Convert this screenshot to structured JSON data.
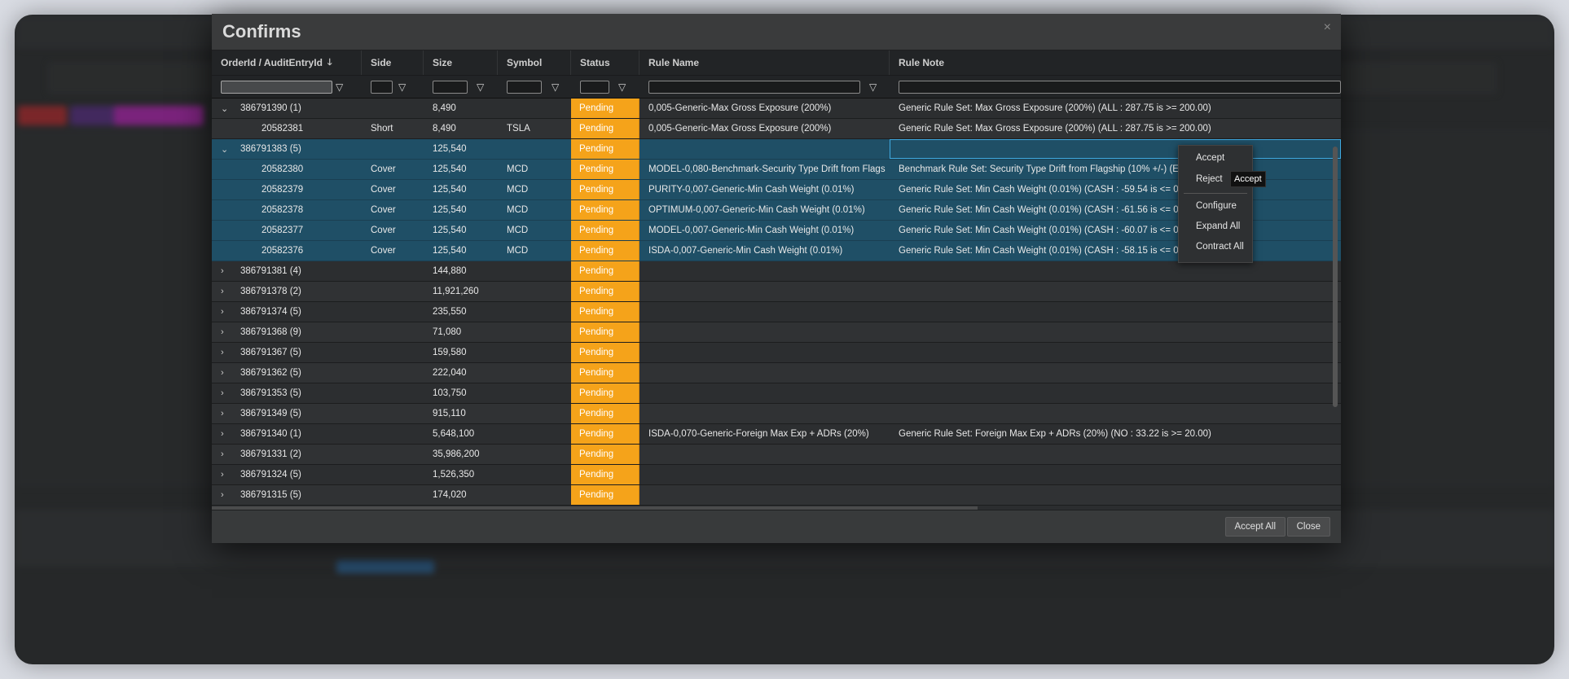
{
  "dialog": {
    "title": "Confirms",
    "close_glyph": "×",
    "accept_all_label": "Accept All",
    "close_label": "Close"
  },
  "columns": [
    {
      "label": "OrderId / AuditEntryId",
      "sorted": "descending"
    },
    {
      "label": "Side"
    },
    {
      "label": "Size"
    },
    {
      "label": "Symbol"
    },
    {
      "label": "Status"
    },
    {
      "label": "Rule Name"
    },
    {
      "label": "Rule Note"
    }
  ],
  "rows": [
    {
      "id": "386791390 (1)",
      "side": "",
      "size": "8,490",
      "symbol": "",
      "status": "Pending",
      "rule_name": "0,005-Generic-Max Gross Exposure (200%)",
      "rule_note": "Generic Rule Set: Max Gross Exposure (200%) (ALL : 287.75 is >= 200.00)"
    },
    {
      "id": "20582381",
      "side": "Short",
      "size": "8,490",
      "symbol": "TSLA",
      "status": "Pending",
      "rule_name": "0,005-Generic-Max Gross Exposure (200%)",
      "rule_note": "Generic Rule Set: Max Gross Exposure (200%) (ALL : 287.75 is >= 200.00)"
    },
    {
      "id": "386791383 (5)",
      "side": "",
      "size": "125,540",
      "symbol": "",
      "status": "Pending",
      "rule_name": "",
      "rule_note": ""
    },
    {
      "id": "20582380",
      "side": "Cover",
      "size": "125,540",
      "symbol": "MCD",
      "status": "Pending",
      "rule_name": "MODEL-0,080-Benchmark-Security Type Drift from Flags",
      "rule_note": "Benchmark Rule Set: Security Type Drift from Flagship (10% +/-) (EQUITY"
    },
    {
      "id": "20582379",
      "side": "Cover",
      "size": "125,540",
      "symbol": "MCD",
      "status": "Pending",
      "rule_name": "PURITY-0,007-Generic-Min Cash Weight (0.01%)",
      "rule_note": "Generic Rule Set: Min Cash Weight (0.01%) (CASH : -59.54 is <= 0.01)"
    },
    {
      "id": "20582378",
      "side": "Cover",
      "size": "125,540",
      "symbol": "MCD",
      "status": "Pending",
      "rule_name": "OPTIMUM-0,007-Generic-Min Cash Weight (0.01%)",
      "rule_note": "Generic Rule Set: Min Cash Weight (0.01%) (CASH : -61.56 is <= 0.01)"
    },
    {
      "id": "20582377",
      "side": "Cover",
      "size": "125,540",
      "symbol": "MCD",
      "status": "Pending",
      "rule_name": "MODEL-0,007-Generic-Min Cash Weight (0.01%)",
      "rule_note": "Generic Rule Set: Min Cash Weight (0.01%) (CASH : -60.07 is <= 0.01)"
    },
    {
      "id": "20582376",
      "side": "Cover",
      "size": "125,540",
      "symbol": "MCD",
      "status": "Pending",
      "rule_name": "ISDA-0,007-Generic-Min Cash Weight (0.01%)",
      "rule_note": "Generic Rule Set: Min Cash Weight (0.01%) (CASH : -58.15 is <= 0.01)"
    },
    {
      "id": "386791381 (4)",
      "side": "",
      "size": "144,880",
      "symbol": "",
      "status": "Pending",
      "rule_name": "",
      "rule_note": ""
    },
    {
      "id": "386791378 (2)",
      "side": "",
      "size": "11,921,260",
      "symbol": "",
      "status": "Pending",
      "rule_name": "",
      "rule_note": ""
    },
    {
      "id": "386791374 (5)",
      "side": "",
      "size": "235,550",
      "symbol": "",
      "status": "Pending",
      "rule_name": "",
      "rule_note": ""
    },
    {
      "id": "386791368 (9)",
      "side": "",
      "size": "71,080",
      "symbol": "",
      "status": "Pending",
      "rule_name": "",
      "rule_note": ""
    },
    {
      "id": "386791367 (5)",
      "side": "",
      "size": "159,580",
      "symbol": "",
      "status": "Pending",
      "rule_name": "",
      "rule_note": ""
    },
    {
      "id": "386791362 (5)",
      "side": "",
      "size": "222,040",
      "symbol": "",
      "status": "Pending",
      "rule_name": "",
      "rule_note": ""
    },
    {
      "id": "386791353 (5)",
      "side": "",
      "size": "103,750",
      "symbol": "",
      "status": "Pending",
      "rule_name": "",
      "rule_note": ""
    },
    {
      "id": "386791349 (5)",
      "side": "",
      "size": "915,110",
      "symbol": "",
      "status": "Pending",
      "rule_name": "",
      "rule_note": ""
    },
    {
      "id": "386791340 (1)",
      "side": "",
      "size": "5,648,100",
      "symbol": "",
      "status": "Pending",
      "rule_name": "ISDA-0,070-Generic-Foreign Max Exp + ADRs (20%)",
      "rule_note": "Generic Rule Set: Foreign Max Exp + ADRs (20%) (NO : 33.22 is >= 20.00)"
    },
    {
      "id": "386791331 (2)",
      "side": "",
      "size": "35,986,200",
      "symbol": "",
      "status": "Pending",
      "rule_name": "",
      "rule_note": ""
    },
    {
      "id": "386791324 (5)",
      "side": "",
      "size": "1,526,350",
      "symbol": "",
      "status": "Pending",
      "rule_name": "",
      "rule_note": ""
    },
    {
      "id": "386791315 (5)",
      "side": "",
      "size": "174,020",
      "symbol": "",
      "status": "Pending",
      "rule_name": "",
      "rule_note": ""
    }
  ],
  "context_menu": {
    "items": [
      "Accept",
      "Reject",
      "Configure",
      "Expand All",
      "Contract All"
    ],
    "tooltip": "Accept"
  },
  "colors": {
    "pending": "#f5a31a",
    "selected_row": "#1f4f66",
    "modal_bg": "#2b2d2f"
  }
}
